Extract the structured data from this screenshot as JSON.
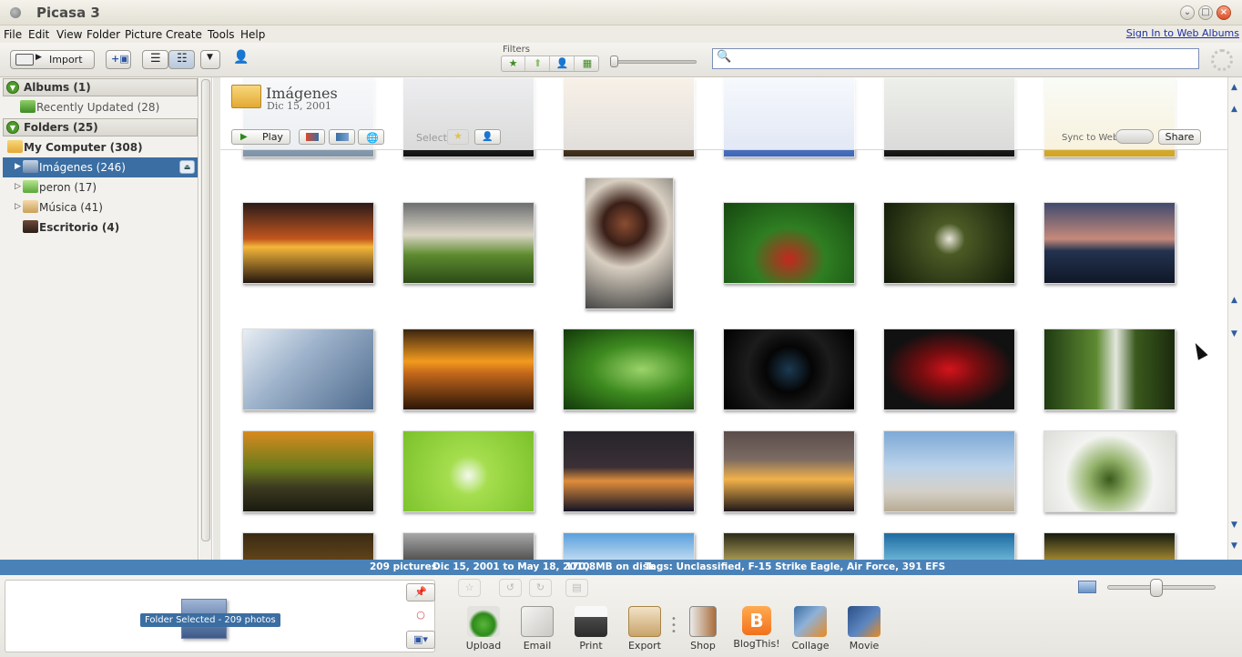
{
  "window": {
    "title": "Picasa 3"
  },
  "menu": {
    "items": [
      "File",
      "Edit",
      "View",
      "Folder",
      "Picture",
      "Create",
      "Tools",
      "Help"
    ],
    "signin_link": "Sign In to Web Albums"
  },
  "toolbar": {
    "import_label": "Import",
    "filters_label": "Filters",
    "search": {
      "value": "",
      "placeholder": ""
    }
  },
  "sidebar": {
    "albums_header": "Albums (1)",
    "recently_updated": "Recently Updated (28)",
    "folders_header": "Folders (25)",
    "my_computer": "My Computer (308)",
    "items": [
      {
        "label": "Imágenes (246)",
        "selected": true
      },
      {
        "label": "peron (17)"
      },
      {
        "label": "Música (41)"
      },
      {
        "label": "Escritorio (4)"
      }
    ]
  },
  "folder": {
    "title": "Imágenes",
    "date": "Dic 15, 2001",
    "play_label": "Play",
    "select_label": "Select",
    "sync_label": "Sync to Web",
    "share_label": "Share"
  },
  "status": {
    "count": "209 pictures",
    "range": "Dic 15, 2001 to May 18, 2010",
    "disk": "170,8MB on disk",
    "tags": "Tags: Unclassified, F-15 Strike Eagle, Air Force, 391 EFS"
  },
  "tray": {
    "label": "Folder Selected - 209 photos"
  },
  "actions": [
    "Upload",
    "Email",
    "Print",
    "Export",
    "Shop",
    "BlogThis!",
    "Collage",
    "Movie"
  ],
  "colors": {
    "selection": "#3b6ea2",
    "statusbar": "#4a82b8",
    "accent_green": "#4d9a2a"
  },
  "zoom": {
    "value": 0.45
  }
}
